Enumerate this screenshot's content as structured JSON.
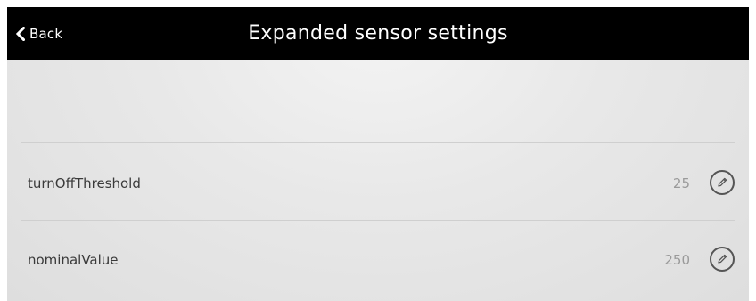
{
  "header": {
    "back_label": "Back",
    "back_icon": "chevron-left-icon",
    "title": "Expanded sensor settings"
  },
  "settings": [
    {
      "name": "turnOffThreshold",
      "value": "25",
      "edit_icon": "pencil-icon"
    },
    {
      "name": "nominalValue",
      "value": "250",
      "edit_icon": "pencil-icon"
    }
  ],
  "colors": {
    "header_bg": "#000000",
    "header_text": "#ffffff",
    "background": "#e6e6e6",
    "label_text": "#3a3a3a",
    "value_text": "#9a9a9a",
    "divider": "#cfcfcf"
  }
}
